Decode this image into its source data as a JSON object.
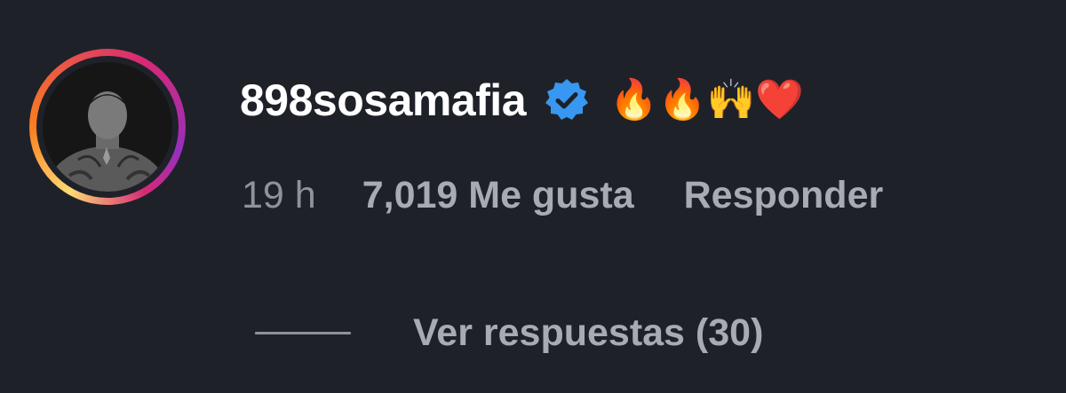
{
  "comment": {
    "username": "898sosamafia",
    "verified_icon": "verified-badge-icon",
    "text": "🔥🔥🙌❤️",
    "timestamp": "19 h",
    "likes": "7,019 Me gusta",
    "reply_label": "Responder",
    "view_replies_label": "Ver respuestas (30)"
  },
  "colors": {
    "background": "#1f2129",
    "username": "#ffffff",
    "meta_text": "#a8abb3",
    "verified_blue": "#3897f0"
  }
}
